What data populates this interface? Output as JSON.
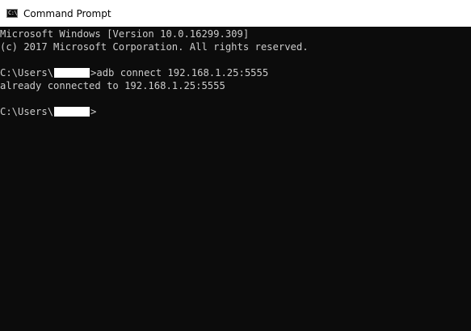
{
  "window": {
    "title": "Command Prompt",
    "icon": "console-app-icon",
    "icon_glyph": "C:\\"
  },
  "console": {
    "lines": {
      "l0": "Microsoft Windows [Version 10.0.16299.309]",
      "l1": "(c) 2017 Microsoft Corporation. All rights reserved.",
      "l3_prefix": "C:\\Users\\",
      "l3_suffix": ">adb connect 192.168.1.25:5555",
      "l4": "already connected to 192.168.1.25:5555",
      "l6_prefix": "C:\\Users\\",
      "l6_suffix": ">"
    }
  },
  "colors": {
    "console_bg": "#0c0c0c",
    "console_text": "#cccccc",
    "titlebar_bg": "#ffffff",
    "redaction": "#ffffff"
  }
}
